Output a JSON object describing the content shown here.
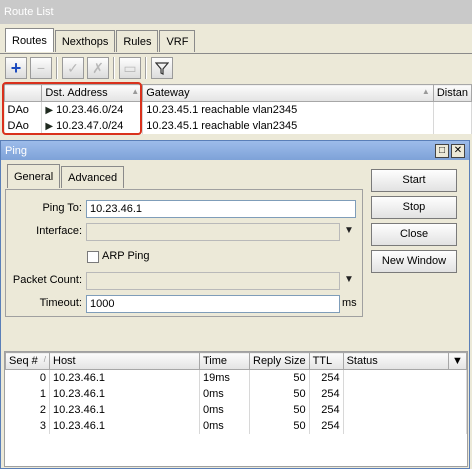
{
  "route_list": {
    "title": "Route List",
    "tabs": [
      "Routes",
      "Nexthops",
      "Rules",
      "VRF"
    ],
    "toolbar": {
      "add": "+",
      "remove": "−",
      "enable": "✓",
      "disable": "✗",
      "comment": "▭",
      "filter": "⊽"
    },
    "columns": [
      "Dst. Address",
      "Gateway",
      "Distan"
    ],
    "rows": [
      {
        "flags": "DAo",
        "dst": "10.23.46.0/24",
        "gateway": "10.23.45.1 reachable vlan2345"
      },
      {
        "flags": "DAo",
        "dst": "10.23.47.0/24",
        "gateway": "10.23.45.1 reachable vlan2345"
      }
    ],
    "sort_glyph": "▲"
  },
  "ping": {
    "title": "Ping",
    "tabs": [
      "General",
      "Advanced"
    ],
    "labels": {
      "ping_to": "Ping To:",
      "interface": "Interface:",
      "arp_ping": "ARP Ping",
      "packet_count": "Packet Count:",
      "timeout": "Timeout:",
      "timeout_unit": "ms"
    },
    "values": {
      "ping_to": "10.23.46.1",
      "interface": "",
      "packet_count": "",
      "timeout": "1000"
    },
    "buttons": [
      "Start",
      "Stop",
      "Close",
      "New Window"
    ],
    "results": {
      "columns": [
        "Seq #",
        "Host",
        "Time",
        "Reply Size",
        "TTL",
        "Status"
      ],
      "rows": [
        {
          "seq": "0",
          "host": "10.23.46.1",
          "time": "19ms",
          "size": "50",
          "ttl": "254",
          "status": ""
        },
        {
          "seq": "1",
          "host": "10.23.46.1",
          "time": "0ms",
          "size": "50",
          "ttl": "254",
          "status": ""
        },
        {
          "seq": "2",
          "host": "10.23.46.1",
          "time": "0ms",
          "size": "50",
          "ttl": "254",
          "status": ""
        },
        {
          "seq": "3",
          "host": "10.23.46.1",
          "time": "0ms",
          "size": "50",
          "ttl": "254",
          "status": ""
        }
      ]
    }
  },
  "colors": {
    "annotation_box": "#d9311c",
    "title_bar": "#7ea2d8",
    "flag_icon": "#1f2a1f"
  }
}
